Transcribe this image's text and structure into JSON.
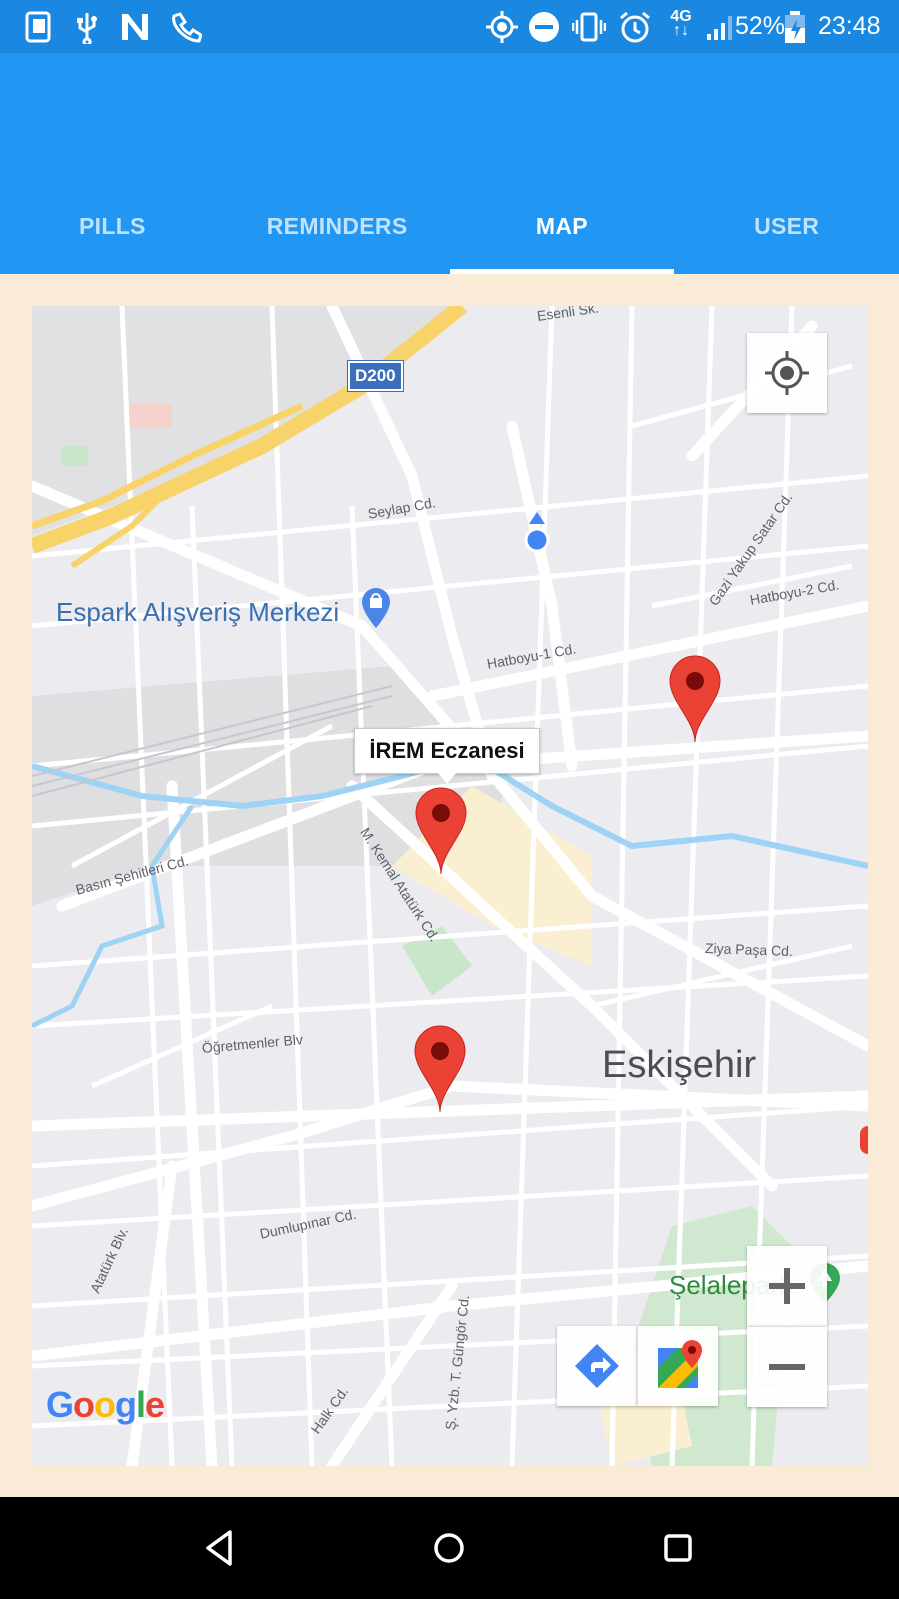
{
  "status_bar": {
    "battery": "52%",
    "time": "23:48",
    "network": "4G",
    "icons_left": [
      "phone-icon",
      "usb-icon",
      "n-notification-icon",
      "call-icon"
    ],
    "icons_right": [
      "location-icon",
      "do-not-disturb-icon",
      "vibrate-icon",
      "alarm-icon",
      "network-4g-icon",
      "signal-icon",
      "battery-icon"
    ]
  },
  "tabs": [
    {
      "label": "PILLS",
      "active": false
    },
    {
      "label": "REMINDERS",
      "active": false
    },
    {
      "label": "MAP",
      "active": true
    },
    {
      "label": "USER",
      "active": false
    }
  ],
  "map": {
    "info_window": "İREM Eczanesi",
    "highway_shield": "D200",
    "poi": "Espark Alışveriş Merkezi",
    "city": "Eskişehir",
    "park": "Şelalepark",
    "streets": {
      "esenli": "Esenli Sk.",
      "seylap": "Seylap Cd.",
      "gazi_yakup": "Gazi Yakup Satar Cd.",
      "hatboyu2": "Hatboyu-2 Cd.",
      "hatboyu1": "Hatboyu-1 Cd.",
      "basin": "Basın Şehitleri Cd.",
      "kemal": "M. Kemal Atatürk Cd.",
      "ziya": "Ziya Paşa Cd.",
      "ogretmenler": "Öğretmenler Blv",
      "dumlupinar": "Dumlupınar Cd.",
      "ataturk": "Atatürk Blv.",
      "gungor": "Ş. Yzb. T. Güngör Cd.",
      "halk": "Halk Cd."
    },
    "logo": "Google",
    "controls": [
      "my-location-button",
      "zoom-in-button",
      "zoom-out-button",
      "directions-button",
      "open-in-maps-button"
    ],
    "colors": {
      "pin": "#ea4335",
      "water": "#9fd3f5",
      "highway": "#f8d36a",
      "park": "#c8e6c9"
    }
  },
  "nav_bar": [
    "back-button",
    "home-button",
    "recents-button"
  ]
}
